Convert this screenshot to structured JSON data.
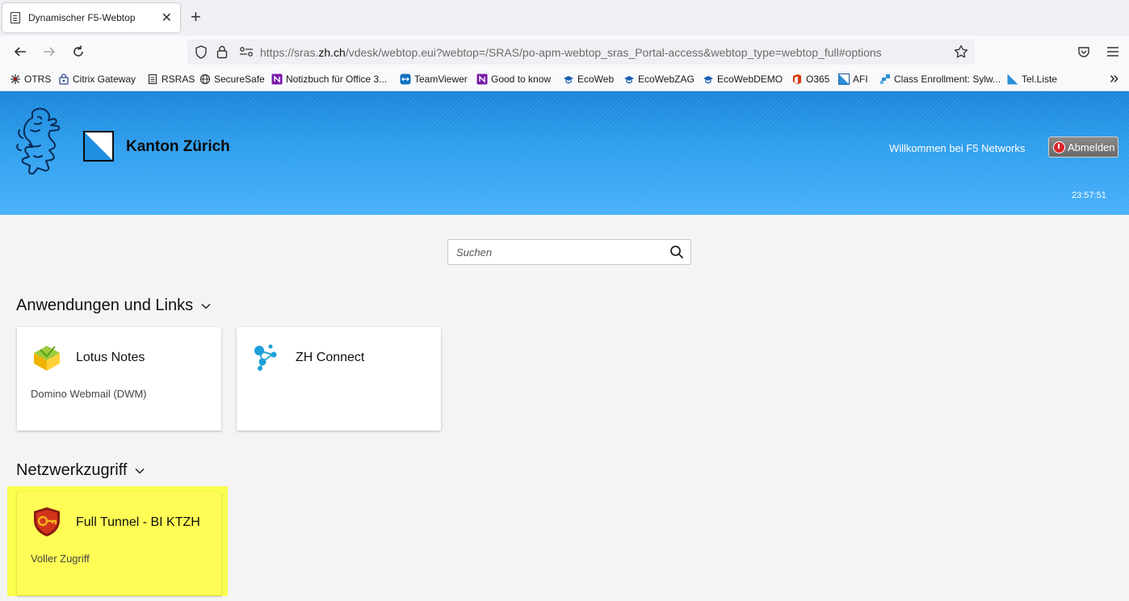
{
  "browser": {
    "tab_title": "Dynamischer F5-Webtop",
    "close_glyph": "✕",
    "new_tab_glyph": "+",
    "url_prefix": "https://sras.",
    "url_domain": "zh.ch",
    "url_path": "/vdesk/webtop.eui?webtop=/SRAS/po-apm-webtop_sras_Portal-access&webtop_type=webtop_full#options",
    "bookmarks": [
      {
        "label": "OTRS",
        "icon": "otrs-icon"
      },
      {
        "label": "Citrix Gateway",
        "icon": "citrix-icon"
      },
      {
        "label": "RSRAS",
        "icon": "page-icon"
      },
      {
        "label": "SecureSafe",
        "icon": "globe-icon"
      },
      {
        "label": "Notizbuch für Office 3...",
        "icon": "onenote-icon"
      },
      {
        "label": "TeamViewer",
        "icon": "teamviewer-icon"
      },
      {
        "label": "Good to know",
        "icon": "onenote-icon"
      },
      {
        "label": "EcoWeb",
        "icon": "eco-icon"
      },
      {
        "label": "EcoWebZAG",
        "icon": "eco-icon"
      },
      {
        "label": "EcoWebDEMO",
        "icon": "eco-icon"
      },
      {
        "label": "O365",
        "icon": "office-icon"
      },
      {
        "label": "AFI",
        "icon": "zh-flag-icon"
      },
      {
        "label": "Class Enrollment: Sylw...",
        "icon": "class-icon"
      },
      {
        "label": "Tel.Liste",
        "icon": "zh-flag-icon"
      }
    ],
    "overflow_glyph": "»"
  },
  "header": {
    "org_name": "Kanton Zürich",
    "welcome": "Willkommen bei F5 Networks",
    "logout_label": "Abmelden",
    "clock": "23:57:51"
  },
  "search": {
    "placeholder": "Suchen",
    "value": ""
  },
  "sections": {
    "apps": {
      "title": "Anwendungen und Links",
      "tiles": [
        {
          "name": "Lotus Notes",
          "description": "Domino Webmail (DWM)",
          "icon": "lotus-notes-icon"
        },
        {
          "name": "ZH Connect",
          "description": "",
          "icon": "zh-connect-icon"
        }
      ]
    },
    "network": {
      "title": "Netzwerkzugriff",
      "tiles": [
        {
          "name": "Full Tunnel - BI KTZH",
          "description": "Voller Zugriff",
          "icon": "vpn-shield-icon"
        }
      ]
    }
  },
  "colors": {
    "header_top": "#1b86da",
    "header_bottom": "#49b1fa",
    "highlight": "#fbff4e",
    "logout_icon": "#d8262b"
  }
}
